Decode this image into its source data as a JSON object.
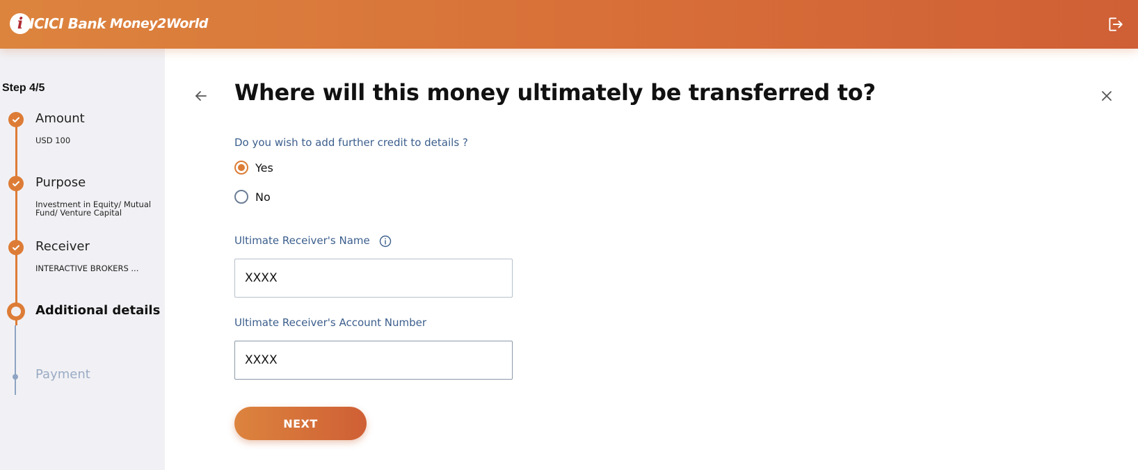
{
  "header": {
    "logo_mark": "i",
    "logo_bank": "ICICI Bank",
    "logo_product": "Money2World",
    "logout_icon": "logout-icon"
  },
  "sidebar": {
    "step_counter": "Step 4/5",
    "steps": [
      {
        "title": "Amount",
        "subtitle": "USD 100",
        "status": "done"
      },
      {
        "title": "Purpose",
        "subtitle": "Investment in Equity/ Mutual Fund/ Venture Capital",
        "status": "done"
      },
      {
        "title": "Receiver",
        "subtitle": "INTERACTIVE BROKERS ...",
        "status": "done"
      },
      {
        "title": "Additional details",
        "subtitle": "",
        "status": "current"
      },
      {
        "title": "Payment",
        "subtitle": "",
        "status": "todo"
      }
    ]
  },
  "main": {
    "title": "Where will this money ultimately be transferred to?",
    "question": "Do you wish to add further credit to details ?",
    "options": [
      {
        "label": "Yes",
        "checked": true
      },
      {
        "label": "No",
        "checked": false
      }
    ],
    "name_field": {
      "label": "Ultimate Receiver's Name",
      "value": "XXXX"
    },
    "account_field": {
      "label": "Ultimate Receiver's Account Number",
      "value": "XXXX"
    },
    "next_label": "NEXT"
  },
  "colors": {
    "accent": "#dd7c36",
    "label_blue": "#3b5e8c",
    "sidebar_bg": "#f1f1f5"
  }
}
